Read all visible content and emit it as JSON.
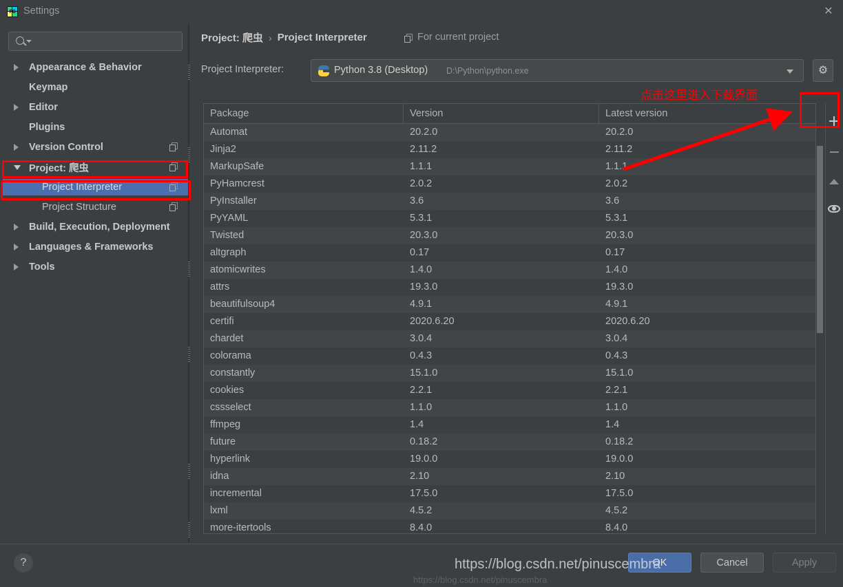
{
  "window": {
    "title": "Settings",
    "app_icon": "pycharm-icon",
    "close_label": "✕"
  },
  "sidebar": {
    "search": {
      "value": "",
      "placeholder": "",
      "icon": "search-icon"
    },
    "items": [
      {
        "label": "Appearance & Behavior",
        "indent": 38,
        "arrow": "right",
        "bold": true,
        "copy": false,
        "selected": false
      },
      {
        "label": "Keymap",
        "indent": 38,
        "arrow": "none",
        "bold": true,
        "copy": false,
        "selected": false
      },
      {
        "label": "Editor",
        "indent": 38,
        "arrow": "right",
        "bold": true,
        "copy": false,
        "selected": false
      },
      {
        "label": "Plugins",
        "indent": 38,
        "arrow": "none",
        "bold": true,
        "copy": false,
        "selected": false
      },
      {
        "label": "Version Control",
        "indent": 38,
        "arrow": "right",
        "bold": true,
        "copy": true,
        "selected": false
      },
      {
        "label": "Project: 爬虫",
        "indent": 38,
        "arrow": "down",
        "bold": true,
        "copy": true,
        "selected": false
      },
      {
        "label": "Project Interpreter",
        "indent": 57,
        "arrow": "none",
        "bold": false,
        "copy": true,
        "selected": true
      },
      {
        "label": "Project Structure",
        "indent": 57,
        "arrow": "none",
        "bold": false,
        "copy": true,
        "selected": false
      },
      {
        "label": "Build, Execution, Deployment",
        "indent": 38,
        "arrow": "right",
        "bold": true,
        "copy": false,
        "selected": false
      },
      {
        "label": "Languages & Frameworks",
        "indent": 38,
        "arrow": "right",
        "bold": true,
        "copy": false,
        "selected": false
      },
      {
        "label": "Tools",
        "indent": 38,
        "arrow": "right",
        "bold": true,
        "copy": false,
        "selected": false
      }
    ]
  },
  "header": {
    "breadcrumb_root": "Project: 爬虫",
    "breadcrumb_sep": "›",
    "breadcrumb_leaf": "Project Interpreter",
    "for_current_project": "For current project",
    "for_current_icon": "copy-icon"
  },
  "interpreter": {
    "label": "Project Interpreter:",
    "icon": "python-icon",
    "name": "Python 3.8 (Desktop)",
    "path": "D:\\Python\\python.exe",
    "dropdown_icon": "chevron-down-icon",
    "gear_icon": "gear-icon",
    "gear_glyph": "⚙"
  },
  "table": {
    "columns": [
      "Package",
      "Version",
      "Latest version"
    ],
    "rows": [
      {
        "package": "Automat",
        "version": "20.2.0",
        "latest": "20.2.0"
      },
      {
        "package": "Jinja2",
        "version": "2.11.2",
        "latest": "2.11.2"
      },
      {
        "package": "MarkupSafe",
        "version": "1.1.1",
        "latest": "1.1.1"
      },
      {
        "package": "PyHamcrest",
        "version": "2.0.2",
        "latest": "2.0.2"
      },
      {
        "package": "PyInstaller",
        "version": "3.6",
        "latest": "3.6"
      },
      {
        "package": "PyYAML",
        "version": "5.3.1",
        "latest": "5.3.1"
      },
      {
        "package": "Twisted",
        "version": "20.3.0",
        "latest": "20.3.0"
      },
      {
        "package": "altgraph",
        "version": "0.17",
        "latest": "0.17"
      },
      {
        "package": "atomicwrites",
        "version": "1.4.0",
        "latest": "1.4.0"
      },
      {
        "package": "attrs",
        "version": "19.3.0",
        "latest": "19.3.0"
      },
      {
        "package": "beautifulsoup4",
        "version": "4.9.1",
        "latest": "4.9.1"
      },
      {
        "package": "certifi",
        "version": "2020.6.20",
        "latest": "2020.6.20"
      },
      {
        "package": "chardet",
        "version": "3.0.4",
        "latest": "3.0.4"
      },
      {
        "package": "colorama",
        "version": "0.4.3",
        "latest": "0.4.3"
      },
      {
        "package": "constantly",
        "version": "15.1.0",
        "latest": "15.1.0"
      },
      {
        "package": "cookies",
        "version": "2.2.1",
        "latest": "2.2.1"
      },
      {
        "package": "cssselect",
        "version": "1.1.0",
        "latest": "1.1.0"
      },
      {
        "package": "ffmpeg",
        "version": "1.4",
        "latest": "1.4"
      },
      {
        "package": "future",
        "version": "0.18.2",
        "latest": "0.18.2"
      },
      {
        "package": "hyperlink",
        "version": "19.0.0",
        "latest": "19.0.0"
      },
      {
        "package": "idna",
        "version": "2.10",
        "latest": "2.10"
      },
      {
        "package": "incremental",
        "version": "17.5.0",
        "latest": "17.5.0"
      },
      {
        "package": "lxml",
        "version": "4.5.2",
        "latest": "4.5.2"
      },
      {
        "package": "more-itertools",
        "version": "8.4.0",
        "latest": "8.4.0"
      }
    ]
  },
  "side_toolbar": {
    "add": "add-package-button",
    "remove": "remove-package-button",
    "upgrade": "upgrade-package-button",
    "show": "show-early-releases-button"
  },
  "footer": {
    "help_label": "?",
    "ok_label": "OK",
    "cancel_label": "Cancel",
    "apply_label": "Apply",
    "watermark": "https://blog.csdn.net/pinuscembra"
  },
  "annotations": {
    "callout_text": "点击这里进入下载界面",
    "color": "#fe0000"
  }
}
